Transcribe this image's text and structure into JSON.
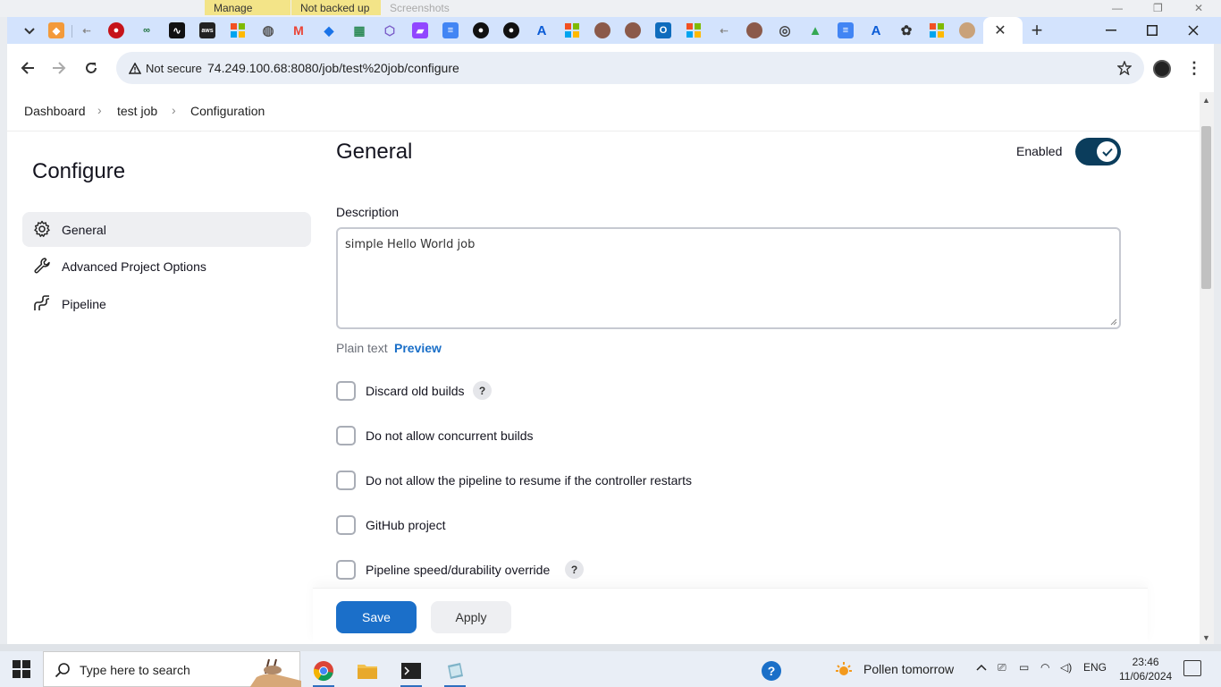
{
  "background_window": {
    "tabs": [
      "Manage",
      "Not backed up",
      "Screenshots"
    ]
  },
  "browser": {
    "address_bar": {
      "security_label": "Not secure",
      "url": "74.249.100.68:8080/job/test%20job/configure"
    },
    "pinned_tab_icons": [
      "box-icon",
      "link-icon",
      "redhat-icon",
      "infinity-icon",
      "stock-icon",
      "aws-icon",
      "microsoft-icon",
      "globe-icon",
      "gmail-icon",
      "diamond-icon",
      "grid-icon",
      "cube-icon",
      "twitch-icon",
      "docs-icon",
      "github-icon",
      "github-icon",
      "azure-icon",
      "microsoft-icon",
      "avatar-icon",
      "avatar-icon",
      "outlook-icon",
      "microsoft-icon",
      "link-icon",
      "avatar-icon",
      "chrome-icon",
      "drive-icon",
      "docs-icon",
      "azure-icon",
      "openai-icon",
      "microsoft-icon",
      "avatar-icon"
    ]
  },
  "breadcrumb": {
    "items": [
      "Dashboard",
      "test job",
      "Configuration"
    ]
  },
  "sidebar": {
    "title": "Configure",
    "items": [
      {
        "label": "General",
        "icon": "gear-icon",
        "active": true
      },
      {
        "label": "Advanced Project Options",
        "icon": "wrench-icon",
        "active": false
      },
      {
        "label": "Pipeline",
        "icon": "pipeline-icon",
        "active": false
      }
    ]
  },
  "general": {
    "title": "General",
    "enabled_label": "Enabled",
    "enabled": true,
    "description_label": "Description",
    "description_value": "simple Hello World job",
    "plain_text_label": "Plain text",
    "preview_label": "Preview",
    "options": [
      {
        "label": "Discard old builds",
        "checked": false,
        "help": "?"
      },
      {
        "label": "Do not allow concurrent builds",
        "checked": false
      },
      {
        "label": "Do not allow the pipeline to resume if the controller restarts",
        "checked": false
      },
      {
        "label": "GitHub project",
        "checked": false
      },
      {
        "label": "Pipeline speed/durability override",
        "checked": false,
        "help": "?"
      }
    ]
  },
  "actions": {
    "save_label": "Save",
    "apply_label": "Apply"
  },
  "taskbar": {
    "search_placeholder": "Type here to search",
    "weather_text": "Pollen tomorrow",
    "language": "ENG",
    "time": "23:46",
    "date": "11/06/2024"
  },
  "colors": {
    "accent": "#1b6fc9",
    "toggle_on": "#0b3d5c",
    "tab_strip": "#d3e3fd"
  }
}
